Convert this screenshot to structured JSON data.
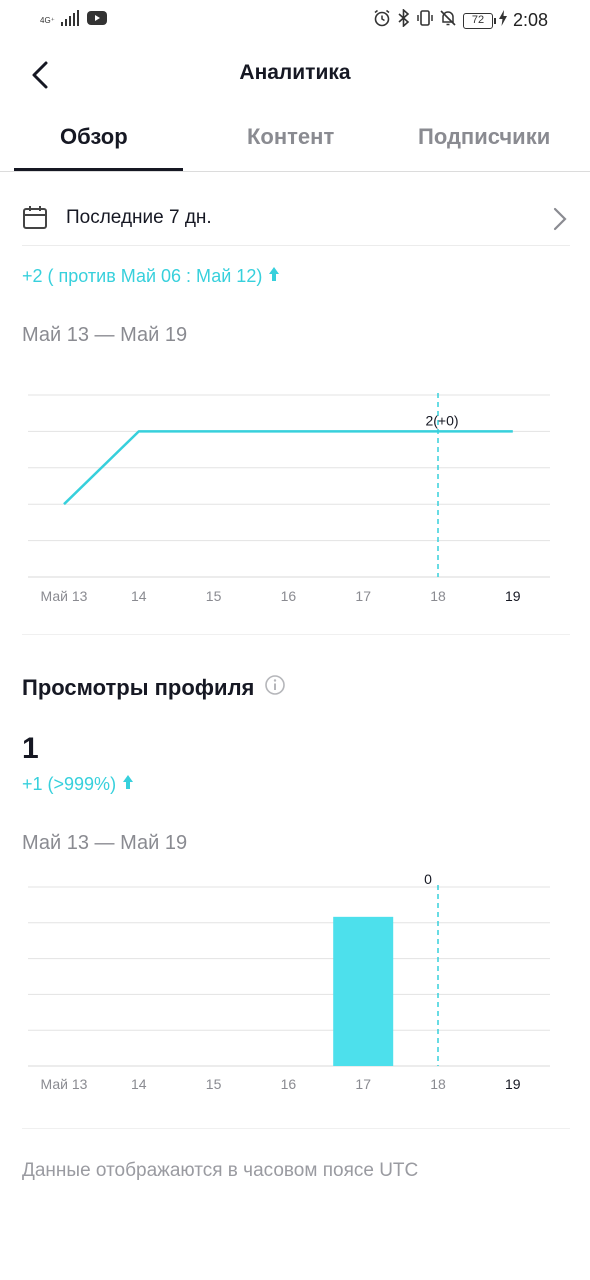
{
  "status_bar": {
    "network": "4G⁺",
    "battery": "72",
    "time": "2:08"
  },
  "header": {
    "title": "Аналитика"
  },
  "tabs": [
    {
      "label": "Обзор",
      "active": true
    },
    {
      "label": "Контент",
      "active": false
    },
    {
      "label": "Подписчики",
      "active": false
    }
  ],
  "date_filter": {
    "label": "Последние 7 дн."
  },
  "followers_summary": {
    "comparison": "+2 ( против Май 06 : Май 12)",
    "range": "Май 13 — Май 19"
  },
  "profile_views": {
    "title": "Просмотры профиля",
    "value": "1",
    "delta": "+1 (>999%)",
    "range": "Май 13 — Май 19"
  },
  "footnote": "Данные отображаются в часовом поясе UTC",
  "colors": {
    "accent": "#37d0dc",
    "bar": "#4de0ec",
    "text": "#161823",
    "muted": "#8a8b91"
  },
  "chart_data": [
    {
      "type": "line",
      "categories": [
        "Май 13",
        "14",
        "15",
        "16",
        "17",
        "18",
        "19"
      ],
      "values": [
        1,
        2,
        2,
        2,
        2,
        2,
        2
      ],
      "ylim": [
        0,
        2.5
      ],
      "grid": true,
      "highlight_index": 5,
      "highlight_label": "2(+0)"
    },
    {
      "type": "bar",
      "categories": [
        "Май 13",
        "14",
        "15",
        "16",
        "17",
        "18",
        "19"
      ],
      "values": [
        0,
        0,
        0,
        0,
        1,
        0,
        0
      ],
      "ylim": [
        0,
        1.2
      ],
      "grid": true,
      "highlight_index": 5,
      "highlight_label": "0"
    }
  ]
}
